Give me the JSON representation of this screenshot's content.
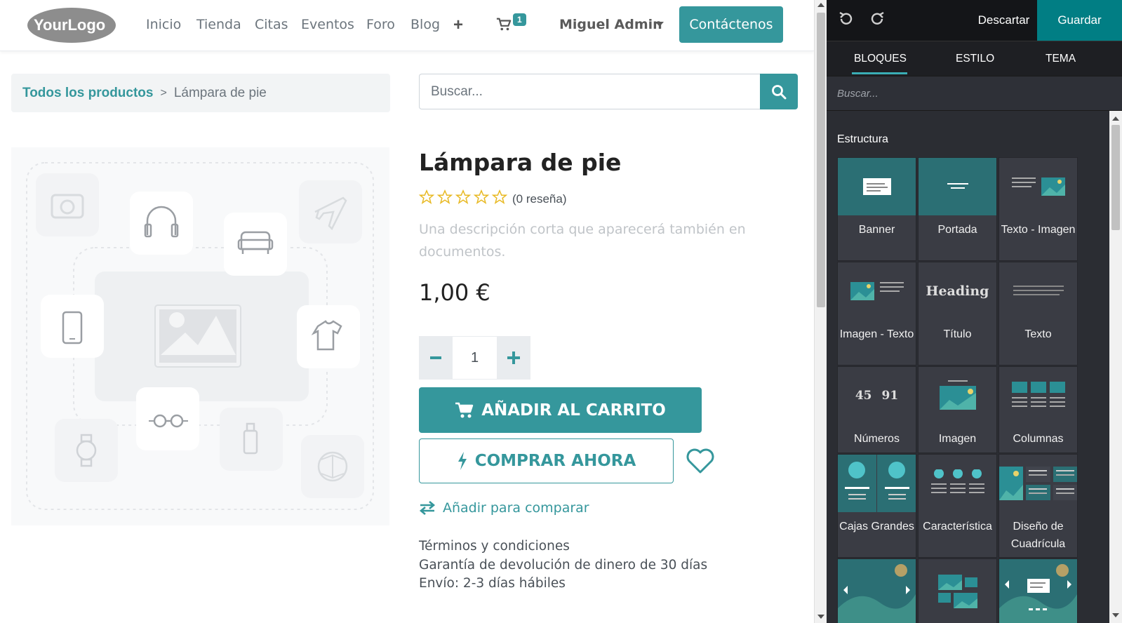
{
  "colors": {
    "brand": "#35979c",
    "editor_bg": "#2b2d33",
    "save": "#017e84"
  },
  "nav": {
    "logo_text": "YourLogo",
    "items": [
      "Inicio",
      "Tienda",
      "Citas",
      "Eventos",
      "Foro",
      "Blog"
    ],
    "cart_count": "1",
    "user": "Miguel Admin",
    "contact": "Contáctenos"
  },
  "breadcrumb": {
    "root": "Todos los productos",
    "current": "Lámpara de pie"
  },
  "search": {
    "placeholder": "Buscar..."
  },
  "product": {
    "title": "Lámpara de pie",
    "rating": 0,
    "reviews": "(0 reseña)",
    "description": "Una descripción corta que aparecerá también en documentos.",
    "price": "1,00 €",
    "quantity": "1",
    "add_to_cart": "AÑADIR AL CARRITO",
    "buy_now": "COMPRAR AHORA",
    "compare": "Añadir para comparar",
    "terms": [
      "Términos y condiciones",
      "Garantía de devolución de dinero de 30 días",
      "Envío: 2-3 días hábiles"
    ]
  },
  "editor": {
    "discard": "Descartar",
    "save": "Guardar",
    "tabs": [
      "BLOQUES",
      "ESTILO",
      "TEMA"
    ],
    "search_placeholder": "Buscar...",
    "section": "Estructura",
    "snippets": [
      {
        "label": "Banner",
        "icon": "banner-icon"
      },
      {
        "label": "Portada",
        "icon": "cover-icon"
      },
      {
        "label": "Texto - Imagen",
        "icon": "text-image-icon"
      },
      {
        "label": "Imagen - Texto",
        "icon": "image-text-icon"
      },
      {
        "label": "Título",
        "icon": "heading-icon",
        "thumb_text": "Heading"
      },
      {
        "label": "Texto",
        "icon": "text-icon"
      },
      {
        "label": "Números",
        "icon": "numbers-icon",
        "thumb_numbers": [
          "45",
          "91"
        ]
      },
      {
        "label": "Imagen",
        "icon": "image-icon"
      },
      {
        "label": "Columnas",
        "icon": "columns-icon"
      },
      {
        "label": "Cajas Grandes",
        "icon": "big-boxes-icon"
      },
      {
        "label": "Característica",
        "icon": "features-icon"
      },
      {
        "label": "Diseño de Cuadrícula",
        "icon": "grid-layout-icon"
      },
      {
        "label": "",
        "icon": "carousel-icon"
      },
      {
        "label": "",
        "icon": "images-wall-icon"
      },
      {
        "label": "",
        "icon": "slider-icon"
      }
    ]
  }
}
